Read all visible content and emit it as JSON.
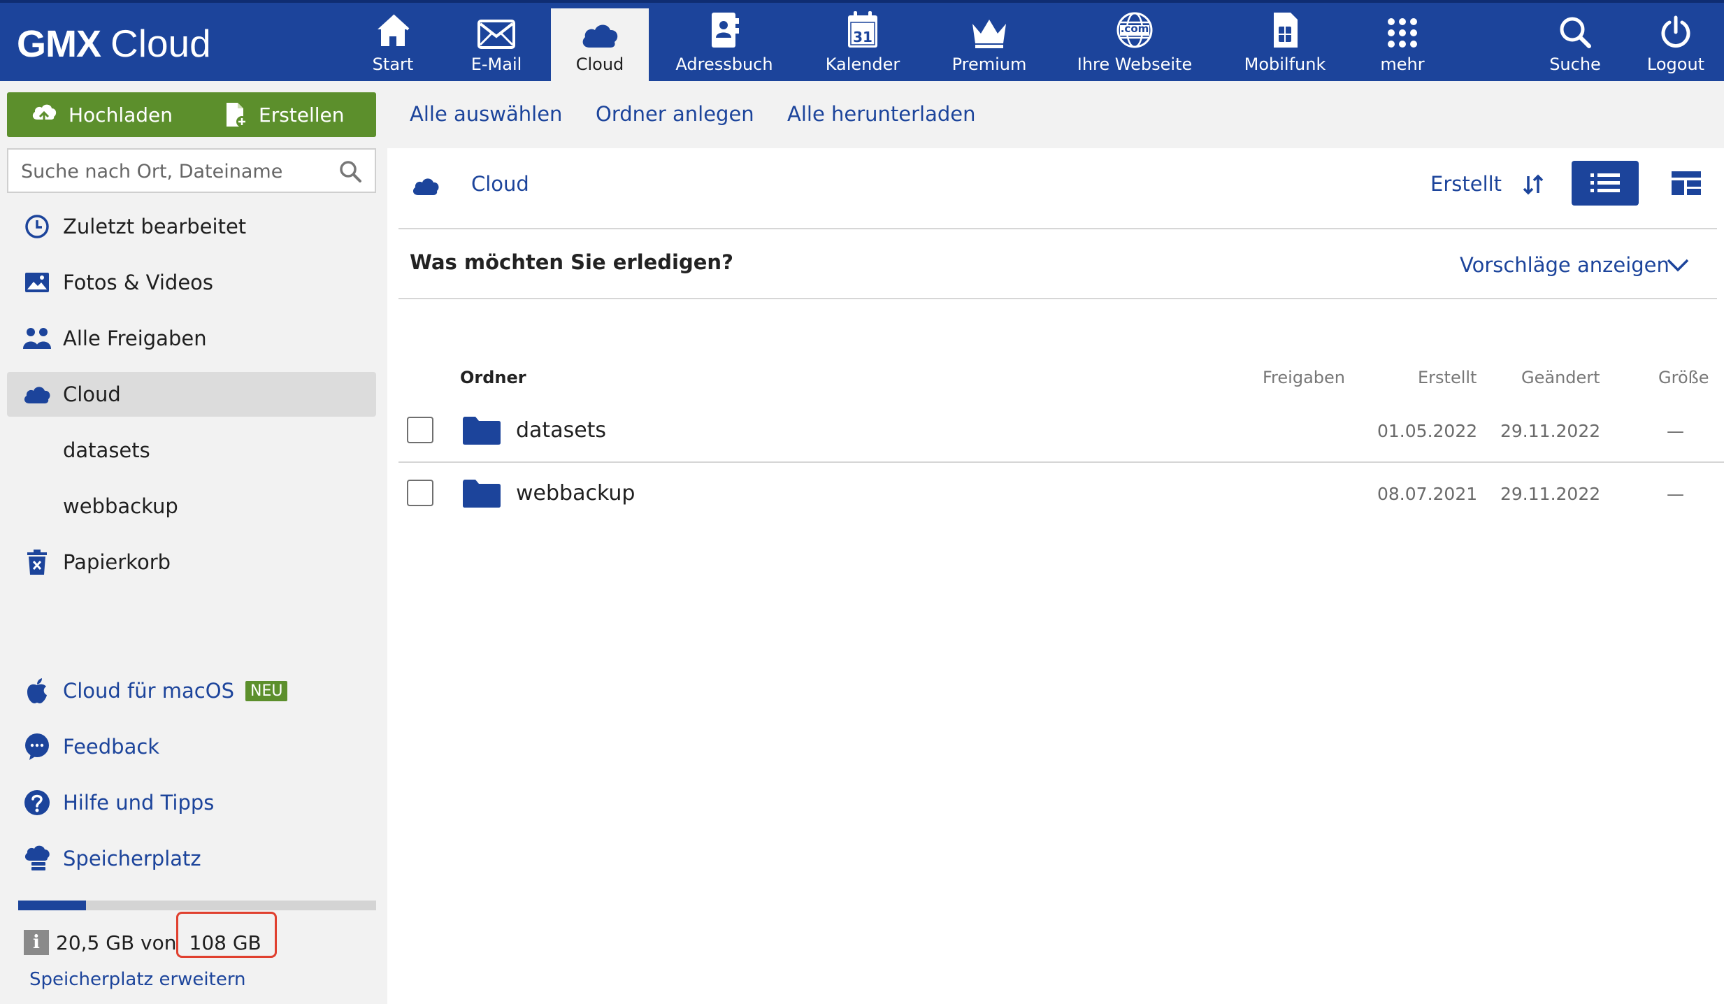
{
  "brand": {
    "name": "GMX",
    "product": "Cloud"
  },
  "topnav": {
    "items": [
      {
        "label": "Start",
        "icon": "home-icon"
      },
      {
        "label": "E-Mail",
        "icon": "mail-icon"
      },
      {
        "label": "Cloud",
        "icon": "cloud-icon",
        "active": true
      },
      {
        "label": "Adressbuch",
        "icon": "address-book-icon"
      },
      {
        "label": "Kalender",
        "icon": "calendar-icon",
        "calendar_day": "31"
      },
      {
        "label": "Premium",
        "icon": "crown-icon"
      },
      {
        "label": "Ihre Webseite",
        "icon": "globe-icon",
        "globe_text": ".com"
      },
      {
        "label": "Mobilfunk",
        "icon": "sim-card-icon"
      },
      {
        "label": "mehr",
        "icon": "apps-grid-icon"
      },
      {
        "label": "Suche",
        "icon": "search-icon"
      },
      {
        "label": "Logout",
        "icon": "power-icon"
      }
    ]
  },
  "sidebar": {
    "upload_label": "Hochladen",
    "create_label": "Erstellen",
    "search_placeholder": "Suche nach Ort, Dateiname",
    "items": [
      {
        "label": "Zuletzt bearbeitet",
        "icon": "clock-icon"
      },
      {
        "label": "Fotos & Videos",
        "icon": "image-icon"
      },
      {
        "label": "Alle Freigaben",
        "icon": "people-icon"
      },
      {
        "label": "Cloud",
        "icon": "cloud-icon",
        "selected": true
      },
      {
        "label": "datasets"
      },
      {
        "label": "webbackup"
      },
      {
        "label": "Papierkorb",
        "icon": "trash-icon"
      }
    ],
    "links": [
      {
        "label": "Cloud für macOS",
        "icon": "apple-icon",
        "badge": "NEU"
      },
      {
        "label": "Feedback",
        "icon": "chat-bubble-icon"
      },
      {
        "label": "Hilfe und Tipps",
        "icon": "help-icon"
      },
      {
        "label": "Speicherplatz",
        "icon": "cloud-storage-icon"
      }
    ],
    "storage": {
      "used_fraction": 0.19,
      "used_text": "20,5 GB von",
      "total_text": "108 GB",
      "info_icon_text": "i",
      "extend_label": "Speicherplatz erweitern"
    }
  },
  "toolbar": {
    "select_all": "Alle auswählen",
    "new_folder": "Ordner anlegen",
    "download_all": "Alle herunterladen"
  },
  "breadcrumb": {
    "label": "Cloud"
  },
  "sort": {
    "label": "Erstellt"
  },
  "suggestions": {
    "question": "Was möchten Sie erledigen?",
    "toggle_label": "Vorschläge anzeigen"
  },
  "table": {
    "columns": {
      "folder": "Ordner",
      "shares": "Freigaben",
      "created": "Erstellt",
      "modified": "Geändert",
      "size": "Größe"
    },
    "rows": [
      {
        "name": "datasets",
        "created": "01.05.2022",
        "modified": "29.11.2022",
        "size": "—"
      },
      {
        "name": "webbackup",
        "created": "08.07.2021",
        "modified": "29.11.2022",
        "size": "—"
      }
    ]
  },
  "colors": {
    "brand_blue": "#1c449b",
    "action_green": "#5c8f2c",
    "highlight_red": "#e0402f",
    "sidebar_bg": "#f2f2f2"
  }
}
